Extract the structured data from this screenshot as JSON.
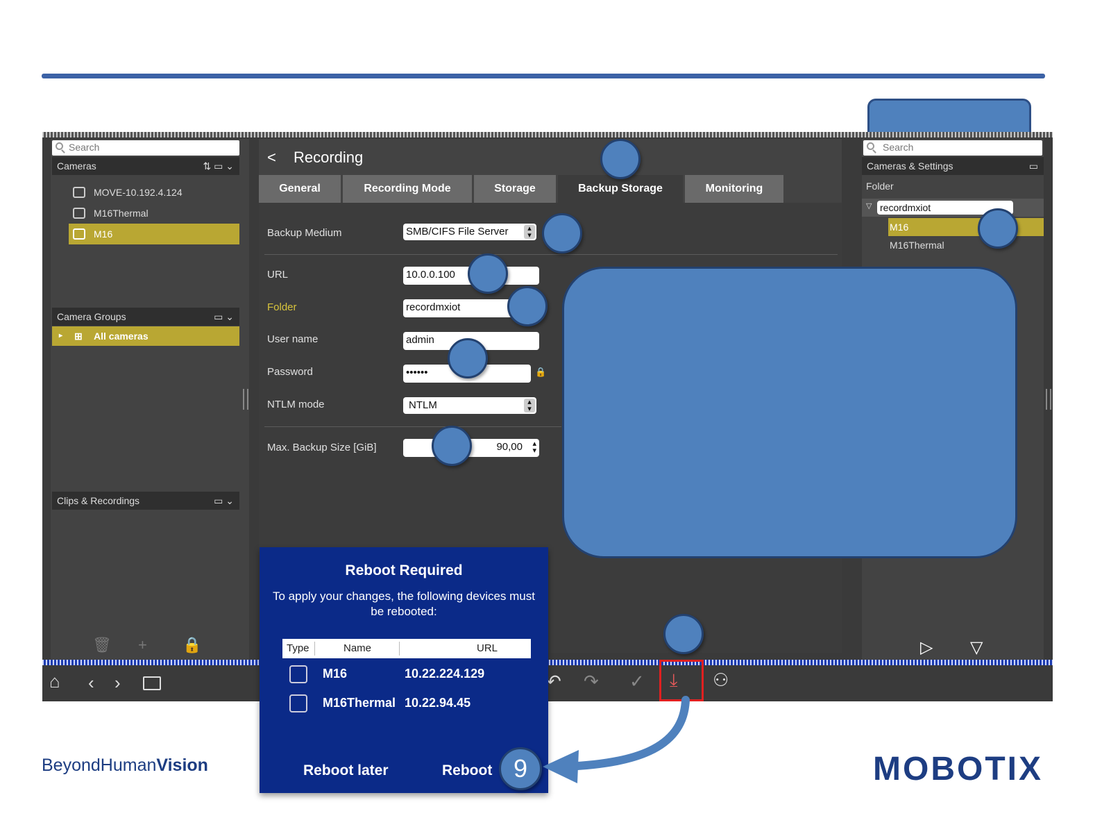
{
  "left_panel": {
    "search_placeholder": "Search",
    "cameras_header": "Cameras",
    "cameras": [
      "MOVE-10.192.4.124",
      "M16Thermal",
      "M16"
    ],
    "camera_groups_header": "Camera Groups",
    "all_cameras": "All cameras",
    "clips_header": "Clips & Recordings"
  },
  "main": {
    "back_label": "<",
    "title": "Recording",
    "tabs": [
      "General",
      "Recording Mode",
      "Storage",
      "Backup Storage",
      "Monitoring"
    ],
    "fields": {
      "backup_medium_label": "Backup Medium",
      "backup_medium_value": "SMB/CIFS File Server",
      "url_label": "URL",
      "url_value": "10.0.0.100",
      "folder_label": "Folder",
      "folder_value": "recordmxiot",
      "username_label": "User name",
      "username_value": "admin",
      "password_label": "Password",
      "password_value": "••••••",
      "ntlm_label": "NTLM mode",
      "ntlm_value": "NTLM",
      "max_backup_label": "Max. Backup Size [GiB]",
      "max_backup_value": "90,00"
    }
  },
  "right_panel": {
    "search_placeholder": "Search",
    "header": "Cameras & Settings",
    "folder_label": "Folder",
    "folder_name": "recordmxiot",
    "items": [
      "M16",
      "M16Thermal"
    ]
  },
  "dialog": {
    "title": "Reboot Required",
    "message": "To apply your changes, the following devices must be rebooted:",
    "columns": [
      "Type",
      "Name",
      "URL"
    ],
    "rows": [
      {
        "name": "M16",
        "url": "10.22.224.129"
      },
      {
        "name": "M16Thermal",
        "url": "10.22.94.45"
      }
    ],
    "reboot_later": "Reboot later",
    "reboot": "Reboot"
  },
  "step_number": "9",
  "footer": {
    "brand_part1": "Beyond",
    "brand_part2": "Human",
    "brand_part3": "Vision",
    "logo": "MOBOTIX"
  },
  "colors": {
    "accent_blue": "#4f81bd",
    "selection_yellow": "#b9a733",
    "dialog_blue": "#0b2a88",
    "highlight_red": "#e02020"
  }
}
